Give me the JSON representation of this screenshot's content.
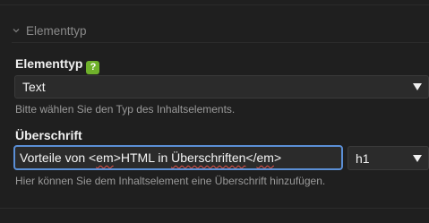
{
  "section": {
    "title": "Elementtyp",
    "icon": "chevron-down-icon"
  },
  "element_type": {
    "label": "Elementtyp",
    "help_badge": "?",
    "help_icon": "help-icon",
    "selected": "Text",
    "hint": "Bitte wählen Sie den Typ des Inhaltselements."
  },
  "heading": {
    "label": "Überschrift",
    "value_prefix": "Vorteile von <",
    "value_em_open": "em",
    "value_middle": ">HTML in ",
    "value_spell": "Überschriften",
    "value_close_tag": "</",
    "value_em_close": "em",
    "value_suffix": ">",
    "level_selected": "h1",
    "hint": "Hier können Sie dem Inhaltselement eine Überschrift hinzufügen."
  },
  "colors": {
    "background": "#1f1f1f",
    "input_focus_border": "#5b8fd6",
    "help_badge": "#6fb12b",
    "spellcheck": "#e0524b"
  }
}
